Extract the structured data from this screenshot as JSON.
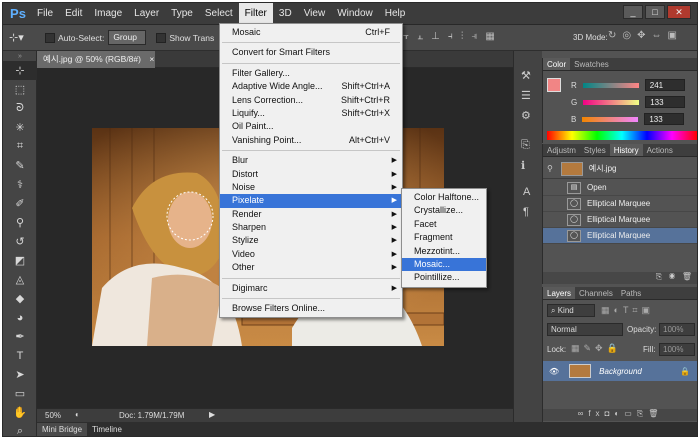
{
  "app": {
    "logo": "Ps"
  },
  "menubar": [
    "File",
    "Edit",
    "Image",
    "Layer",
    "Type",
    "Select",
    "Filter",
    "3D",
    "View",
    "Window",
    "Help"
  ],
  "window_controls": {
    "minimize": "_",
    "restore": "□",
    "close": "✕"
  },
  "options_bar": {
    "auto_select_label": "Auto-Select:",
    "group_value": "Group",
    "show_transform_label": "Show Trans",
    "mode_3d_label": "3D Mode:"
  },
  "doc_tab": {
    "title": "예시.jpg @ 50% (RGB/8#)",
    "close": "×"
  },
  "status": {
    "zoom": "50%",
    "doc": "Doc: 1.79M/1.79M"
  },
  "bottom_tabs": [
    "Mini Bridge",
    "Timeline"
  ],
  "filter_menu": {
    "top": [
      {
        "label": "Mosaic",
        "shortcut": "Ctrl+F"
      }
    ],
    "smart": [
      {
        "label": "Convert for Smart Filters",
        "shortcut": ""
      }
    ],
    "gallery": [
      {
        "label": "Filter Gallery...",
        "shortcut": ""
      },
      {
        "label": "Adaptive Wide Angle...",
        "shortcut": "Shift+Ctrl+A"
      },
      {
        "label": "Lens Correction...",
        "shortcut": "Shift+Ctrl+R"
      },
      {
        "label": "Liquify...",
        "shortcut": "Shift+Ctrl+X"
      },
      {
        "label": "Oil Paint...",
        "shortcut": ""
      },
      {
        "label": "Vanishing Point...",
        "shortcut": "Alt+Ctrl+V"
      }
    ],
    "submenus": [
      "Blur",
      "Distort",
      "Noise",
      "Pixelate",
      "Render",
      "Sharpen",
      "Stylize",
      "Video",
      "Other"
    ],
    "highlighted": "Pixelate",
    "plugins": [
      "Digimarc"
    ],
    "online": "Browse Filters Online..."
  },
  "pixelate_menu": {
    "items": [
      "Color Halftone...",
      "Crystallize...",
      "Facet",
      "Fragment",
      "Mezzotint...",
      "Mosaic...",
      "Pointillize..."
    ],
    "highlighted": "Mosaic..."
  },
  "color_panel": {
    "tabs": [
      "Color",
      "Swatches"
    ],
    "channels": [
      {
        "label": "R",
        "value": "241"
      },
      {
        "label": "G",
        "value": "133"
      },
      {
        "label": "B",
        "value": "133"
      }
    ],
    "swatch": "#f18585"
  },
  "history_panel": {
    "tabs": [
      "Adjustm",
      "Styles",
      "History",
      "Actions"
    ],
    "snapshot": "예시.jpg",
    "items": [
      "Open",
      "Elliptical Marquee",
      "Elliptical Marquee",
      "Elliptical Marquee"
    ]
  },
  "layers_panel": {
    "tabs": [
      "Layers",
      "Channels",
      "Paths"
    ],
    "kind": "Kind",
    "blend_mode": "Normal",
    "opacity_label": "Opacity:",
    "opacity": "100%",
    "lock_label": "Lock:",
    "fill_label": "Fill:",
    "fill": "100%",
    "layer_name": "Background"
  },
  "side_strip": {
    "text_tool": "A",
    "paragraph": "¶"
  }
}
